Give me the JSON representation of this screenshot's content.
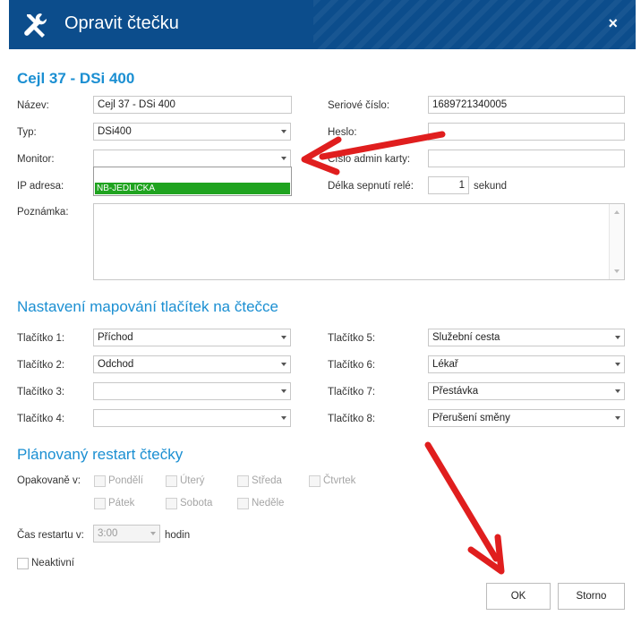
{
  "window": {
    "title": "Opravit čtečku",
    "close_glyph": "×",
    "accent": "#0c4d8c"
  },
  "reader": {
    "heading": "Cejl 37 - DSi 400",
    "nazev_label": "Název:",
    "nazev_value": "Cejl 37 - DSi 400",
    "typ_label": "Typ:",
    "typ_value": "DSi400",
    "monitor_label": "Monitor:",
    "monitor_value": "",
    "monitor_options": [
      "",
      "NB-JEDLICKA"
    ],
    "ip_label": "IP adresa:",
    "note_label": "Poznámka:",
    "serial_label": "Seriové číslo:",
    "serial_value": "1689721340005",
    "heslo_label": "Heslo:",
    "heslo_value": "",
    "admin_label": "Číslo admin karty:",
    "admin_value": "",
    "rele_label": "Délka sepnutí relé:",
    "rele_value": "1",
    "rele_unit": "sekund"
  },
  "mapping": {
    "heading": "Nastavení mapování tlačítek na čtečce",
    "buttons": [
      {
        "label": "Tlačítko 1:",
        "value": "Příchod"
      },
      {
        "label": "Tlačítko 2:",
        "value": "Odchod"
      },
      {
        "label": "Tlačítko 3:",
        "value": ""
      },
      {
        "label": "Tlačítko 4:",
        "value": ""
      },
      {
        "label": "Tlačítko 5:",
        "value": "Služební cesta"
      },
      {
        "label": "Tlačítko 6:",
        "value": "Lékař"
      },
      {
        "label": "Tlačítko 7:",
        "value": "Přestávka"
      },
      {
        "label": "Tlačítko 8:",
        "value": "Přerušení směny"
      }
    ]
  },
  "restart": {
    "heading": "Plánovaný restart čtečky",
    "repeat_label": "Opakovaně v:",
    "days": [
      "Pondělí",
      "Úterý",
      "Středa",
      "Čtvrtek",
      "Pátek",
      "Sobota",
      "Neděle"
    ],
    "time_label": "Čas restartu v:",
    "time_value": "3:00",
    "time_unit": "hodin",
    "inactive_label": "Neaktivní"
  },
  "actions": {
    "ok_label": "OK",
    "cancel_label": "Storno"
  },
  "annotation": {
    "arrow_color": "#e01e1e"
  }
}
